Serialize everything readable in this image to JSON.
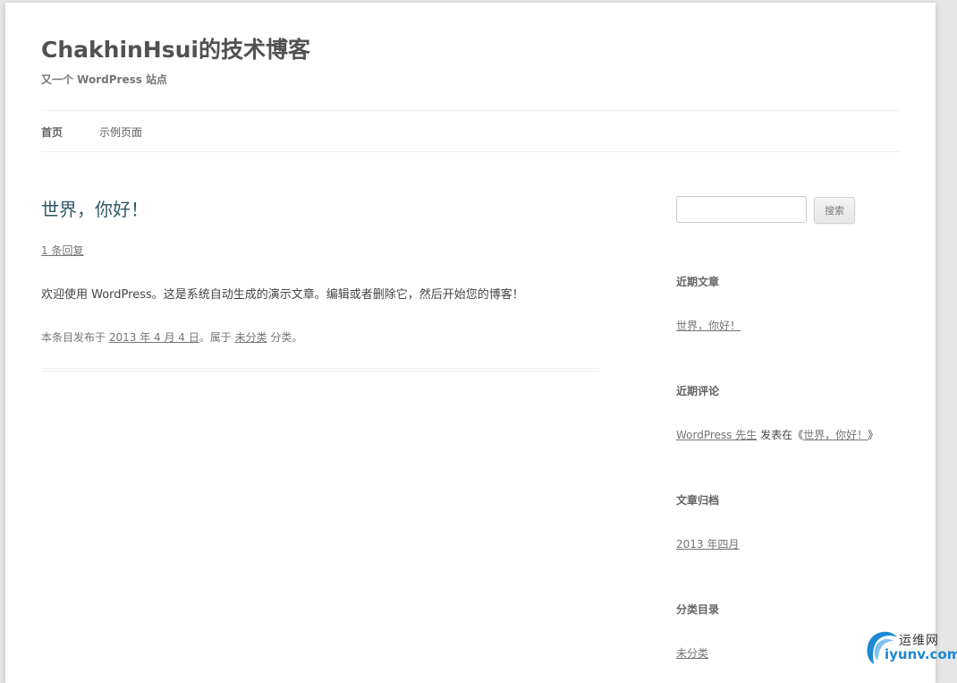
{
  "site": {
    "title": "ChakhinHsui的技术博客",
    "description": "又一个 WordPress 站点"
  },
  "nav": {
    "items": [
      {
        "label": "首页"
      },
      {
        "label": "示例页面"
      }
    ]
  },
  "post": {
    "title": "世界，你好！",
    "comments_link": "1 条回复",
    "content": "欢迎使用 WordPress。这是系统自动生成的演示文章。编辑或者删除它，然后开始您的博客！",
    "meta": {
      "prefix": "本条目发布于",
      "date": "2013 年 4 月 4 日",
      "mid": "。属于",
      "category": "未分类",
      "suffix": "分类。"
    }
  },
  "sidebar": {
    "search": {
      "value": "",
      "button_label": "搜索"
    },
    "recent_posts": {
      "title": "近期文章",
      "items": [
        "世界，你好！"
      ]
    },
    "recent_comments": {
      "title": "近期评论",
      "author": "WordPress 先生",
      "connector": "发表在《",
      "post": "世界，你好！",
      "close": "》"
    },
    "archives": {
      "title": "文章归档",
      "items": [
        "2013 年四月"
      ]
    },
    "categories": {
      "title": "分类目录",
      "items": [
        "未分类"
      ]
    }
  },
  "watermark": {
    "top": "运维网",
    "bottom": "iyunv.com",
    "accent": "#1e88d2"
  }
}
